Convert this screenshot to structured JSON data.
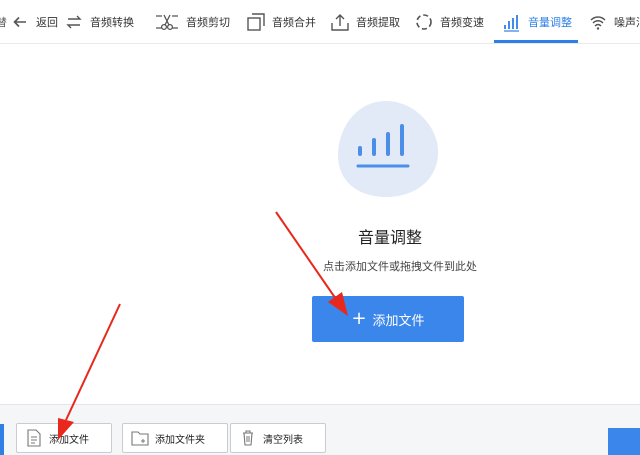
{
  "toolbar": {
    "items": [
      {
        "label": "返回",
        "icon": "arrow-left-icon"
      },
      {
        "label": "音频转换",
        "icon": "swap-arrows-icon"
      },
      {
        "label": "音频剪切",
        "icon": "scissors-icon"
      },
      {
        "label": "音频合并",
        "icon": "merge-squares-icon"
      },
      {
        "label": "音频提取",
        "icon": "upload-tray-icon"
      },
      {
        "label": "音频变速",
        "icon": "dotted-ring-icon"
      },
      {
        "label": "音量调整",
        "icon": "volume-bars-icon",
        "active": true
      },
      {
        "label": "噪声消",
        "icon": "wifi-waves-icon"
      }
    ],
    "left_cut_glyph": "替"
  },
  "main": {
    "title": "音量调整",
    "subtitle": "点击添加文件或拖拽文件到此处",
    "add_button_label": "添加文件",
    "hero_icon": "volume-bars-icon"
  },
  "bottom": {
    "add_file_label": "添加文件",
    "add_folder_label": "添加文件夹",
    "clear_list_label": "清空列表"
  },
  "colors": {
    "accent": "#2f7fe6",
    "button": "#3b86ea",
    "hero_bg": "#e3eaf7",
    "annotation": "#e8281c"
  }
}
